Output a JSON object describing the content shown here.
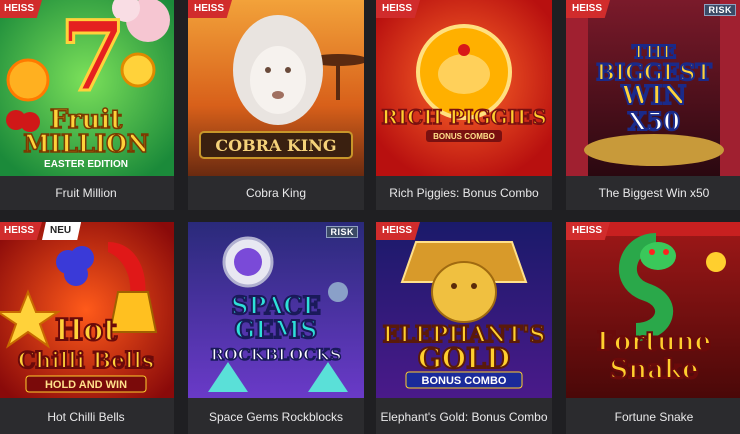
{
  "badges": {
    "hot": "HEISS",
    "new": "NEU",
    "risk": "RISK"
  },
  "games": [
    {
      "title": "Fruit Million",
      "logo_lines": [
        "Fruit",
        "MILLION"
      ],
      "sub": "EASTER EDITION",
      "bg": "#2aa84a",
      "accent": "#ffd23a"
    },
    {
      "title": "Cobra King",
      "logo_lines": [
        "COBRA KING"
      ],
      "sub": "",
      "bg": "#d86b1c",
      "accent": "#f5d27a"
    },
    {
      "title": "Rich Piggies: Bonus Combo",
      "logo_lines": [
        "RICH PIGGIES"
      ],
      "sub": "BONUS COMBO",
      "bg": "#d41a1a",
      "accent": "#ffcf2e"
    },
    {
      "title": "The Biggest Win x50",
      "logo_lines": [
        "THE",
        "BIGGEST",
        "WIN",
        "X50"
      ],
      "sub": "",
      "bg": "#5a1020",
      "accent": "#ffd23a"
    },
    {
      "title": "Hot Chilli Bells",
      "logo_lines": [
        "Hot",
        "Chilli Bells"
      ],
      "sub": "HOLD AND WIN",
      "bg": "#b0140f",
      "accent": "#ffcf2e"
    },
    {
      "title": "Space Gems Rockblocks",
      "logo_lines": [
        "SPACE",
        "GEMS",
        "ROCKBLOCKS"
      ],
      "sub": "",
      "bg": "#3a3fb0",
      "accent": "#2ee0d8"
    },
    {
      "title": "Elephant's Gold: Bonus Combo",
      "logo_lines": [
        "ELEPHANT'S",
        "GOLD"
      ],
      "sub": "BONUS COMBO",
      "bg": "#2a1880",
      "accent": "#ffcf2e"
    },
    {
      "title": "Fortune Snake",
      "logo_lines": [
        "Fortune",
        "Snake"
      ],
      "sub": "",
      "bg": "#8c1010",
      "accent": "#ffcf2e"
    }
  ]
}
